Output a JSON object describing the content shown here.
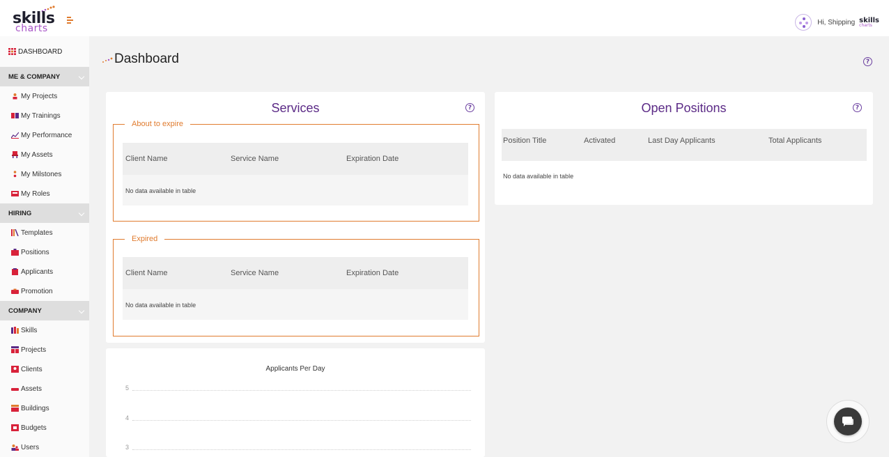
{
  "brand": {
    "logo_word": "skills",
    "logo_sub": "charts",
    "accent": "#e07b2e",
    "purple": "#5b2a86"
  },
  "header": {
    "greeting": "Hi, Shipping",
    "mini_logo_word": "skills",
    "mini_logo_sub": "charts"
  },
  "sidebar": {
    "dashboard": "DASHBOARD",
    "groups": [
      {
        "title": "ME & COMPANY",
        "items": [
          "My Projects",
          "My Trainings",
          "My Performance",
          "My Assets",
          "My Milstones",
          "My Roles"
        ]
      },
      {
        "title": "HIRING",
        "items": [
          "Templates",
          "Positions",
          "Applicants",
          "Promotion"
        ]
      },
      {
        "title": "COMPANY",
        "items": [
          "Skills",
          "Projects",
          "Clients",
          "Assets",
          "Buildings",
          "Budgets",
          "Users"
        ]
      }
    ]
  },
  "page": {
    "title": "Dashboard"
  },
  "services": {
    "title": "Services",
    "about_to_expire": {
      "legend": "About to expire",
      "columns": [
        "Client Name",
        "Service Name",
        "Expiration Date"
      ],
      "empty": "No data available in table"
    },
    "expired": {
      "legend": "Expired",
      "columns": [
        "Client Name",
        "Service Name",
        "Expiration Date"
      ],
      "empty": "No data available in table"
    }
  },
  "open_positions": {
    "title": "Open Positions",
    "columns": [
      "Position Title",
      "Activated",
      "Last Day Applicants",
      "Total Applicants"
    ],
    "empty": "No data available in table"
  },
  "applicants_chart": {
    "title": "Applicants Per Day",
    "y_ticks": [
      "5",
      "4",
      "3"
    ]
  },
  "chart_data": {
    "type": "line",
    "title": "Applicants Per Day",
    "xlabel": "",
    "ylabel": "",
    "y_ticks_visible": [
      5,
      4,
      3
    ],
    "series": []
  }
}
